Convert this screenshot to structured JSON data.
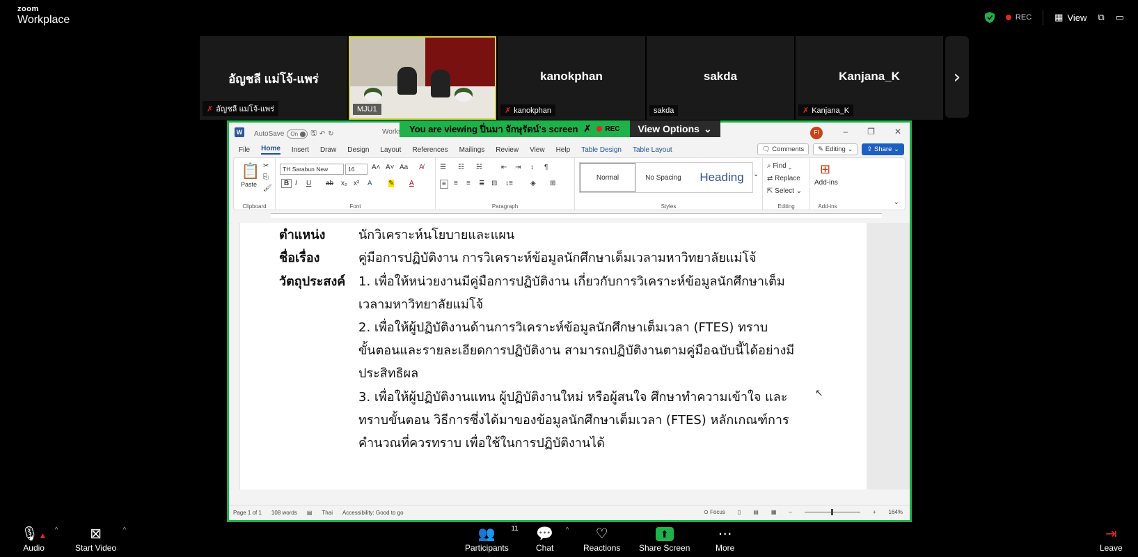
{
  "app": {
    "brand_top": "zoom",
    "brand_bottom": "Workplace"
  },
  "topbar": {
    "rec_label": "REC",
    "view_label": "View"
  },
  "participants": [
    {
      "name": "อัญชลี แม่โจ้-แพร่",
      "label": "อัญชลี แม่โจ้-แพร่",
      "muted": true
    },
    {
      "name": "",
      "label": "MJU1",
      "muted": false,
      "video": true
    },
    {
      "name": "kanokphan",
      "label": "kanokphan",
      "muted": true
    },
    {
      "name": "sakda",
      "label": "sakda",
      "muted": false
    },
    {
      "name": "Kanjana_K",
      "label": "Kanjana_K",
      "muted": true
    }
  ],
  "share_banner": {
    "viewing_text": "You are viewing  ปิ่นมา จักษุรัตน์'s screen",
    "rec_label": "REC",
    "view_options": "View Options"
  },
  "word": {
    "autosave_label": "AutoSave",
    "autosave_state": "On",
    "doc_name": "Works",
    "user_initials": "FI",
    "menu": [
      "File",
      "Home",
      "Insert",
      "Draw",
      "Design",
      "Layout",
      "References",
      "Mailings",
      "Review",
      "View",
      "Help",
      "Table Design",
      "Table Layout"
    ],
    "comments_label": "Comments",
    "editing_label": "Editing",
    "share_label": "Share",
    "font_name": "TH Sarabun New",
    "font_size": "16",
    "paste_label": "Paste",
    "groups": {
      "clipboard": "Clipboard",
      "font": "Font",
      "paragraph": "Paragraph",
      "styles": "Styles",
      "editing": "Editing",
      "addins": "Add-ins"
    },
    "styles": [
      "Normal",
      "No Spacing",
      "Heading"
    ],
    "editing_items": [
      "Find",
      "Replace",
      "Select"
    ],
    "addins_label": "Add-ins",
    "status": {
      "page": "Page 1 of 1",
      "words": "108 words",
      "lang": "Thai",
      "accessibility": "Accessibility: Good to go",
      "focus": "Focus",
      "zoom": "164%"
    }
  },
  "document": {
    "label_position": "ตำแหน่ง",
    "value_position": "นักวิเคราะห์นโยบายและแผน",
    "label_title": "ชื่อเรื่อง",
    "value_title": "คู่มือการปฏิบัติงาน การวิเคราะห์ข้อมูลนักศึกษาเต็มเวลามหาวิทยาลัยแม่โจ้",
    "label_objective": "วัตถุประสงค์",
    "lines": [
      "1. เพื่อให้หน่วยงานมีคู่มือการปฏิบัติงาน เกี่ยวกับการวิเคราะห์ข้อมูลนักศึกษาเต็ม",
      "เวลามหาวิทยาลัยแม่โจ้",
      "2. เพื่อให้ผู้ปฏิบัติงานด้านการวิเคราะห์ข้อมูลนักศึกษาเต็มเวลา (FTES) ทราบ",
      "ขั้นตอนและรายละเอียดการปฏิบัติงาน สามารถปฏิบัติงานตามคู่มือฉบับนี้ได้อย่างมี",
      "ประสิทธิผล",
      "3. เพื่อให้ผู้ปฏิบัติงานแทน ผู้ปฏิบัติงานใหม่ หรือผู้สนใจ ศึกษาทำความเข้าใจ และ",
      "ทราบขั้นตอน วิธีการซึ่งได้มาของข้อมูลนักศึกษาเต็มเวลา (FTES) หลักเกณฑ์การ",
      "คำนวณที่ควรทราบ เพื่อใช้ในการปฏิบัติงานได้"
    ]
  },
  "toolbar": {
    "audio": "Audio",
    "start_video": "Start Video",
    "participants": "Participants",
    "participants_count": "11",
    "chat": "Chat",
    "reactions": "Reactions",
    "share_screen": "Share Screen",
    "more": "More",
    "leave": "Leave"
  },
  "colors": {
    "accent_green": "#1fb14a",
    "rec_red": "#e02828",
    "word_blue": "#2b579a"
  }
}
